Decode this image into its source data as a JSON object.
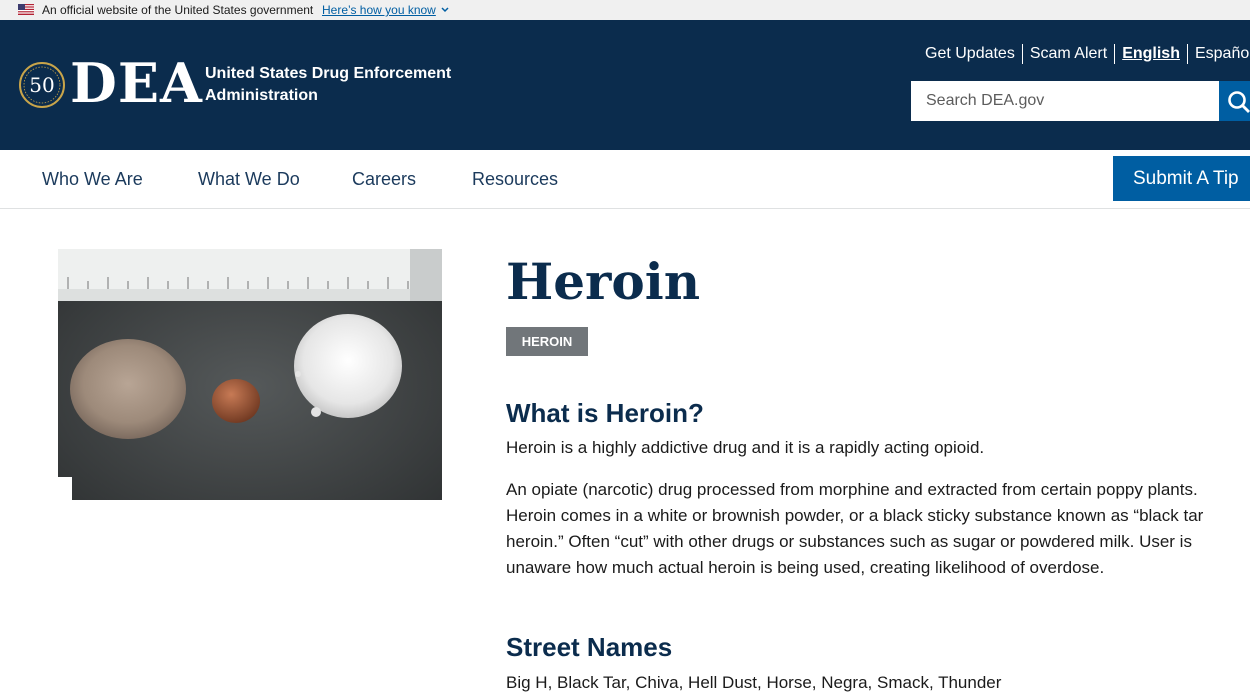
{
  "gov_banner": {
    "text": "An official website of the United States government",
    "link": "Here’s how you know"
  },
  "header": {
    "logo_text": "DEA",
    "seal_text": "50",
    "agency_name": "United States Drug Enforcement Administration",
    "utility_links": [
      "Get Updates",
      "Scam Alert",
      "English",
      "Españo"
    ],
    "search_placeholder": "Search DEA.gov"
  },
  "nav": {
    "items": [
      "Who We Are",
      "What We Do",
      "Careers",
      "Resources"
    ],
    "tip_button": "Submit A Tip"
  },
  "article": {
    "title": "Heroin",
    "tag": "HEROIN",
    "section1_heading": "What is Heroin?",
    "section1_p1": "Heroin is a highly addictive drug and it is a rapidly acting opioid.",
    "section1_p2": "An opiate (narcotic) drug processed from morphine and extracted from certain poppy plants. Heroin comes in a white or brownish powder, or a black sticky substance known as “black tar heroin.” Often “cut” with other drugs or substances such as sugar or powdered milk. User is unaware how much actual heroin is being used, creating likelihood of overdose.",
    "section2_heading": "Street Names",
    "section2_text": "Big H, Black Tar, Chiva, Hell Dust, Horse, Negra, Smack, Thunder"
  },
  "colors": {
    "header_bg": "#0b2c4d",
    "primary_blue": "#005ea2",
    "tag_gray": "#71767a"
  }
}
